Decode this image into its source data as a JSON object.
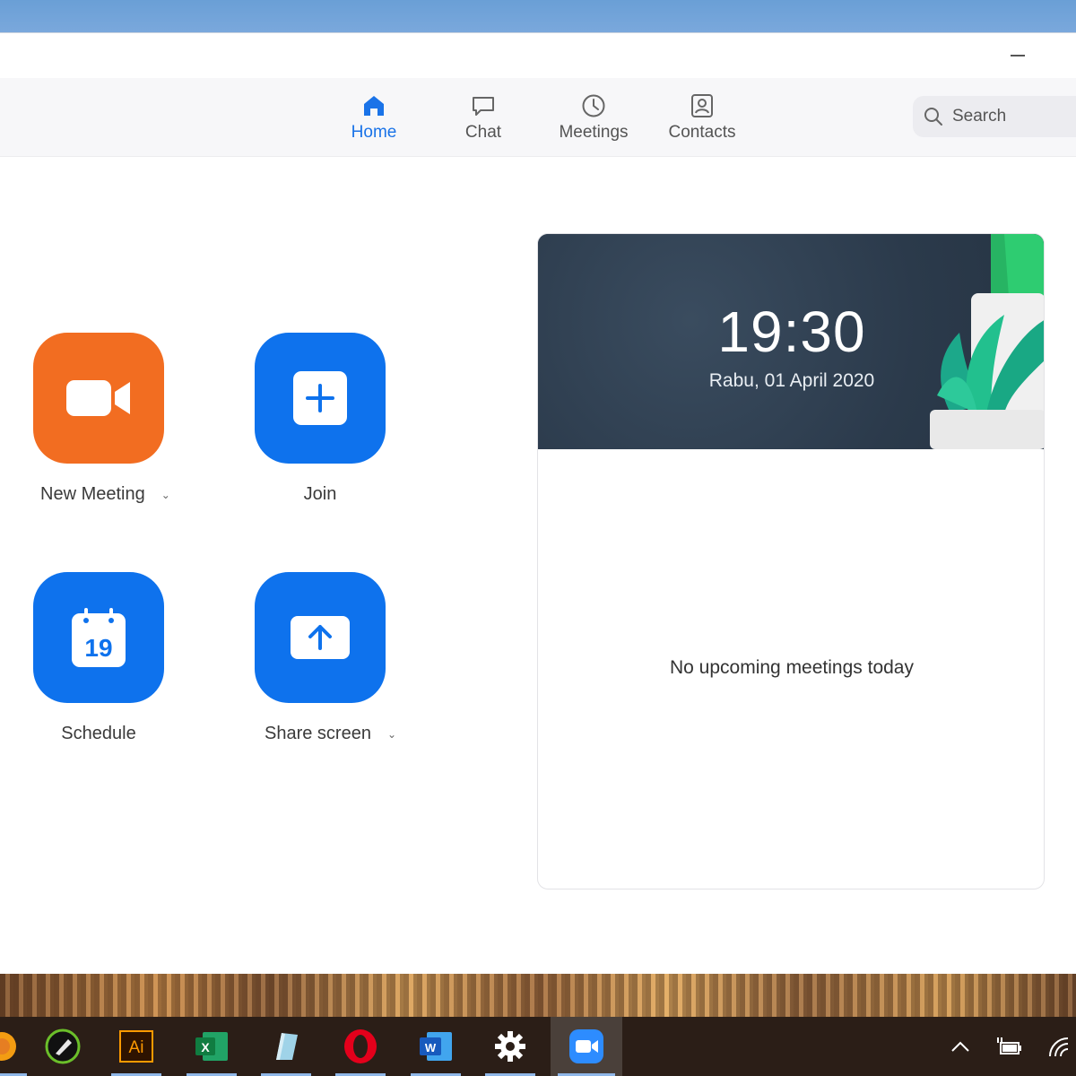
{
  "window": {
    "minimize_label": "Minimize"
  },
  "nav": {
    "tabs": [
      {
        "label": "Home",
        "icon": "home-icon",
        "active": true
      },
      {
        "label": "Chat",
        "icon": "chat-icon"
      },
      {
        "label": "Meetings",
        "icon": "clock-icon"
      },
      {
        "label": "Contacts",
        "icon": "contacts-icon"
      }
    ],
    "search": {
      "placeholder": "Search"
    }
  },
  "actions": {
    "new_meeting": {
      "label": "New Meeting",
      "icon": "video-camera-icon"
    },
    "join": {
      "label": "Join",
      "icon": "plus-icon"
    },
    "schedule": {
      "label": "Schedule",
      "icon": "calendar-icon",
      "day": "19"
    },
    "share_screen": {
      "label": "Share screen",
      "icon": "upload-arrow-icon"
    }
  },
  "card": {
    "time": "19:30",
    "date": "Rabu, 01 April 2020",
    "empty_message": "No upcoming meetings today"
  },
  "taskbar": {
    "apps": [
      "firefox-icon",
      "inkscape-icon",
      "illustrator-icon",
      "excel-icon",
      "notepad-icon",
      "opera-icon",
      "word-icon",
      "settings-icon",
      "zoom-icon"
    ],
    "illustrator_text": "Ai",
    "excel_text": "X",
    "word_text": "W"
  },
  "colors": {
    "accent": "#0e72ed",
    "orange": "#f26d21",
    "active_tab": "#1a73e8"
  }
}
